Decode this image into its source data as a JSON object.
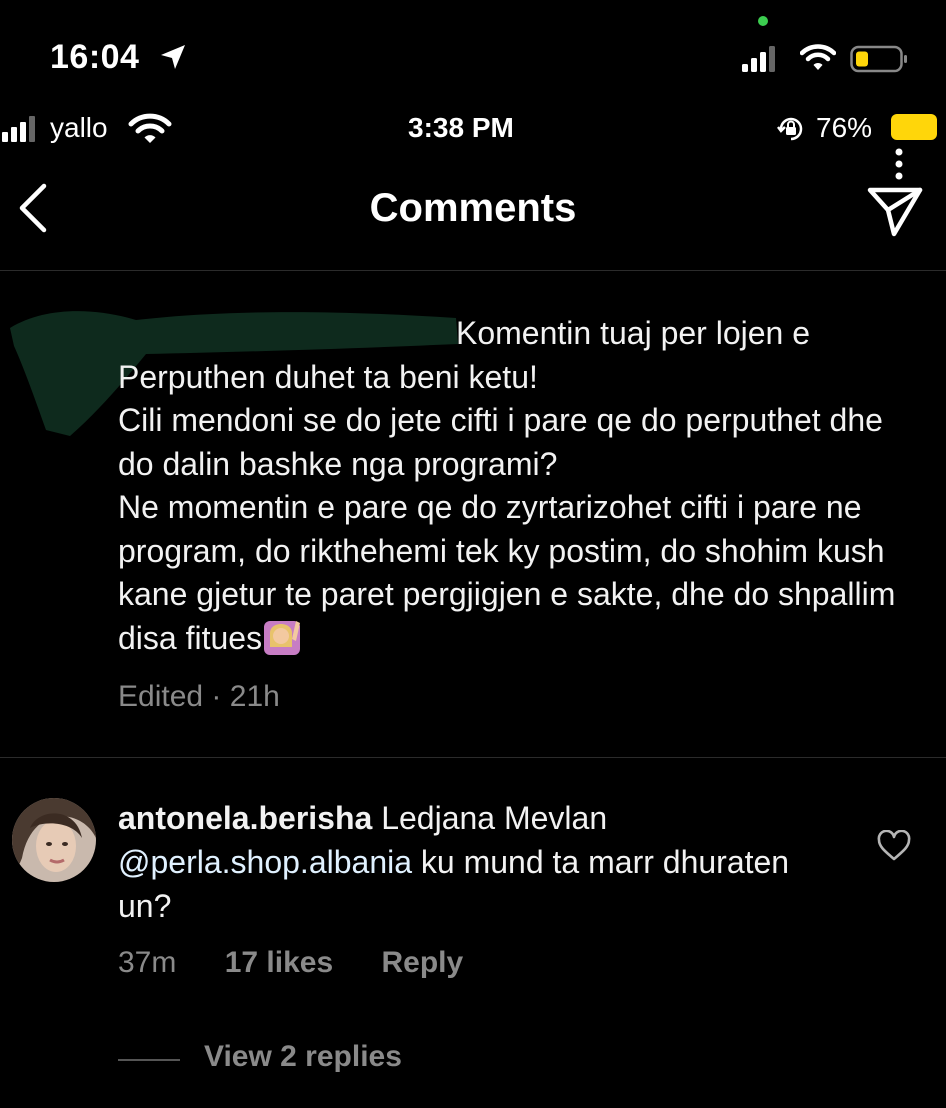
{
  "outer_status": {
    "time": "16:04"
  },
  "inner_status": {
    "carrier": "yallo",
    "time": "3:38 PM",
    "battery": "76%"
  },
  "nav": {
    "title": "Comments"
  },
  "caption": {
    "line1": "Komentin tuaj per lojen e",
    "rest": "Perputhen duhet ta beni ketu!\nCili mendoni se do jete cifti i pare qe do perputhet dhe do dalin bashke nga programi?\nNe momentin e pare qe do zyrtarizohet cifti i pare ne program, do rikthehemi tek ky postim, do shohim kush kane gjetur te paret pergjigjen e sakte, dhe do shpallim disa fitues",
    "edited": "Edited",
    "separator": "·",
    "age": "21h"
  },
  "comment": {
    "username": "antonela.berisha",
    "text_before": "Ledjana Mevlan",
    "mention": "@perla.shop.albania",
    "text_after": "ku mund ta marr dhuraten un?",
    "age": "37m",
    "likes": "17 likes",
    "reply_label": "Reply",
    "view_replies": "View 2 replies"
  },
  "colors": {
    "background": "#000000",
    "text": "#f2f2f2",
    "muted": "#8a8a8a",
    "battery_yellow": "#ffd60a",
    "status_green": "#3ccd50"
  }
}
